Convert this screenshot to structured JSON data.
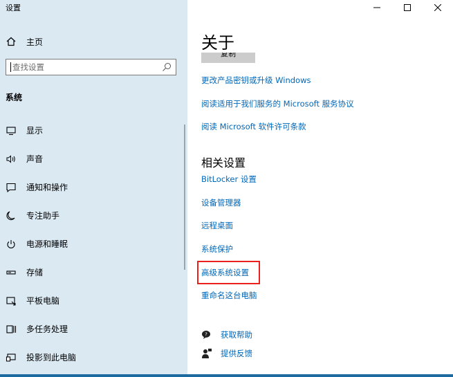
{
  "window": {
    "title": "设置",
    "controls": {
      "minimize": "–",
      "maximize": "□",
      "close": "✕"
    }
  },
  "sidebar": {
    "home_label": "主页",
    "search_placeholder": "查找设置",
    "section_title": "系统",
    "items": [
      {
        "label": "显示",
        "icon": "monitor-icon"
      },
      {
        "label": "声音",
        "icon": "speaker-icon"
      },
      {
        "label": "通知和操作",
        "icon": "notification-icon"
      },
      {
        "label": "专注助手",
        "icon": "moon-icon"
      },
      {
        "label": "电源和睡眠",
        "icon": "power-icon"
      },
      {
        "label": "存储",
        "icon": "storage-icon"
      },
      {
        "label": "平板电脑",
        "icon": "tablet-icon"
      },
      {
        "label": "多任务处理",
        "icon": "multitask-icon"
      },
      {
        "label": "投影到此电脑",
        "icon": "project-icon"
      }
    ]
  },
  "main": {
    "title": "关于",
    "copy_button": "复制",
    "links": [
      "更改产品密钥或升级 Windows",
      "阅读适用于我们服务的 Microsoft 服务协议",
      "阅读 Microsoft 软件许可条款"
    ],
    "related_title": "相关设置",
    "related_links": [
      "BitLocker 设置",
      "设备管理器",
      "远程桌面",
      "系统保护",
      "高级系统设置",
      "重命名这台电脑"
    ],
    "help": {
      "get_help": "获取帮助",
      "feedback": "提供反馈"
    }
  },
  "colors": {
    "sidebar_bg": "#dbe9f3",
    "link": "#0067b8",
    "highlight": "#e8221b"
  }
}
